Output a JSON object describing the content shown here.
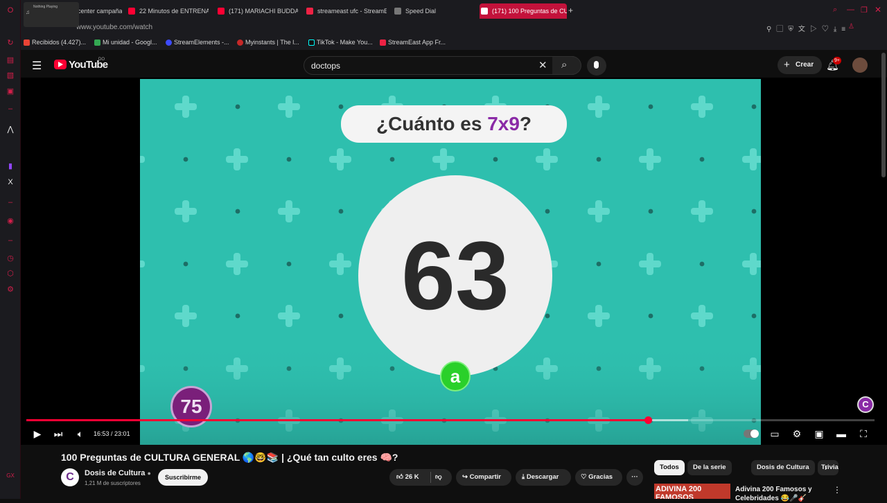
{
  "browser": {
    "tabs": [
      {
        "label": "Guía call center campaña",
        "active": false
      },
      {
        "label": "22 Minutos de ENTRENA",
        "active": false
      },
      {
        "label": "(171) MARIACHI BUDDA S",
        "active": false
      },
      {
        "label": "streameast ufc - StreamE",
        "active": false
      },
      {
        "label": "Speed Dial",
        "active": false
      },
      {
        "label": "(171) 100 Preguntas de CU",
        "active": true
      }
    ],
    "url": "www.youtube.com/watch",
    "player_popup": "Nothing Playing",
    "bookmarks": [
      "Recibidos (4.427)...",
      "Mi unidad - Googl...",
      "StreamElements -...",
      "Myinstants | The l...",
      "TikTok - Make You...",
      "StreamEast App Fr..."
    ],
    "sidebar_bottom_label": "GX"
  },
  "youtube": {
    "logo_text": "YouTube",
    "logo_region": "DO",
    "search_value": "doctops",
    "create_label": "Crear",
    "notifications_badge": "9+"
  },
  "video_frame": {
    "question_prefix": "¿Cuánto es ",
    "question_highlight": "7x9",
    "question_suffix": "?",
    "answer": "63",
    "option_letter": "a",
    "question_number": "75",
    "corner_logo": "C"
  },
  "player": {
    "time_current": "16:53",
    "time_total": "23:01",
    "progress": 0.733,
    "buffered": 0.78
  },
  "video_info": {
    "title": "100 Preguntas de CULTURA GENERAL 🌎🤓📚 | ¿Qué tan culto eres 🧠?",
    "channel_name": "Dosis de Cultura",
    "channel_avatar": "C",
    "subscribers": "1,21 M de suscriptores",
    "subscribe_label": "Suscribirme",
    "likes": "26 K",
    "share_label": "Compartir",
    "download_label": "Descargar",
    "thanks_label": "Gracias",
    "more_label": "···"
  },
  "recommendations": {
    "chips": [
      "Todos",
      "De la serie",
      "Dosis de Cultura",
      "Trivia"
    ],
    "first_title": "Adivina 200 Famosos y Celebridades 😂🎤🎸",
    "first_thumb_text": "ADIVINA 200 FAMOSOS"
  },
  "colors": {
    "accent": "#ff0033",
    "opera_red": "#c3123b",
    "video_bg": "#2ebfae",
    "question_highlight": "#8a2aa6"
  }
}
